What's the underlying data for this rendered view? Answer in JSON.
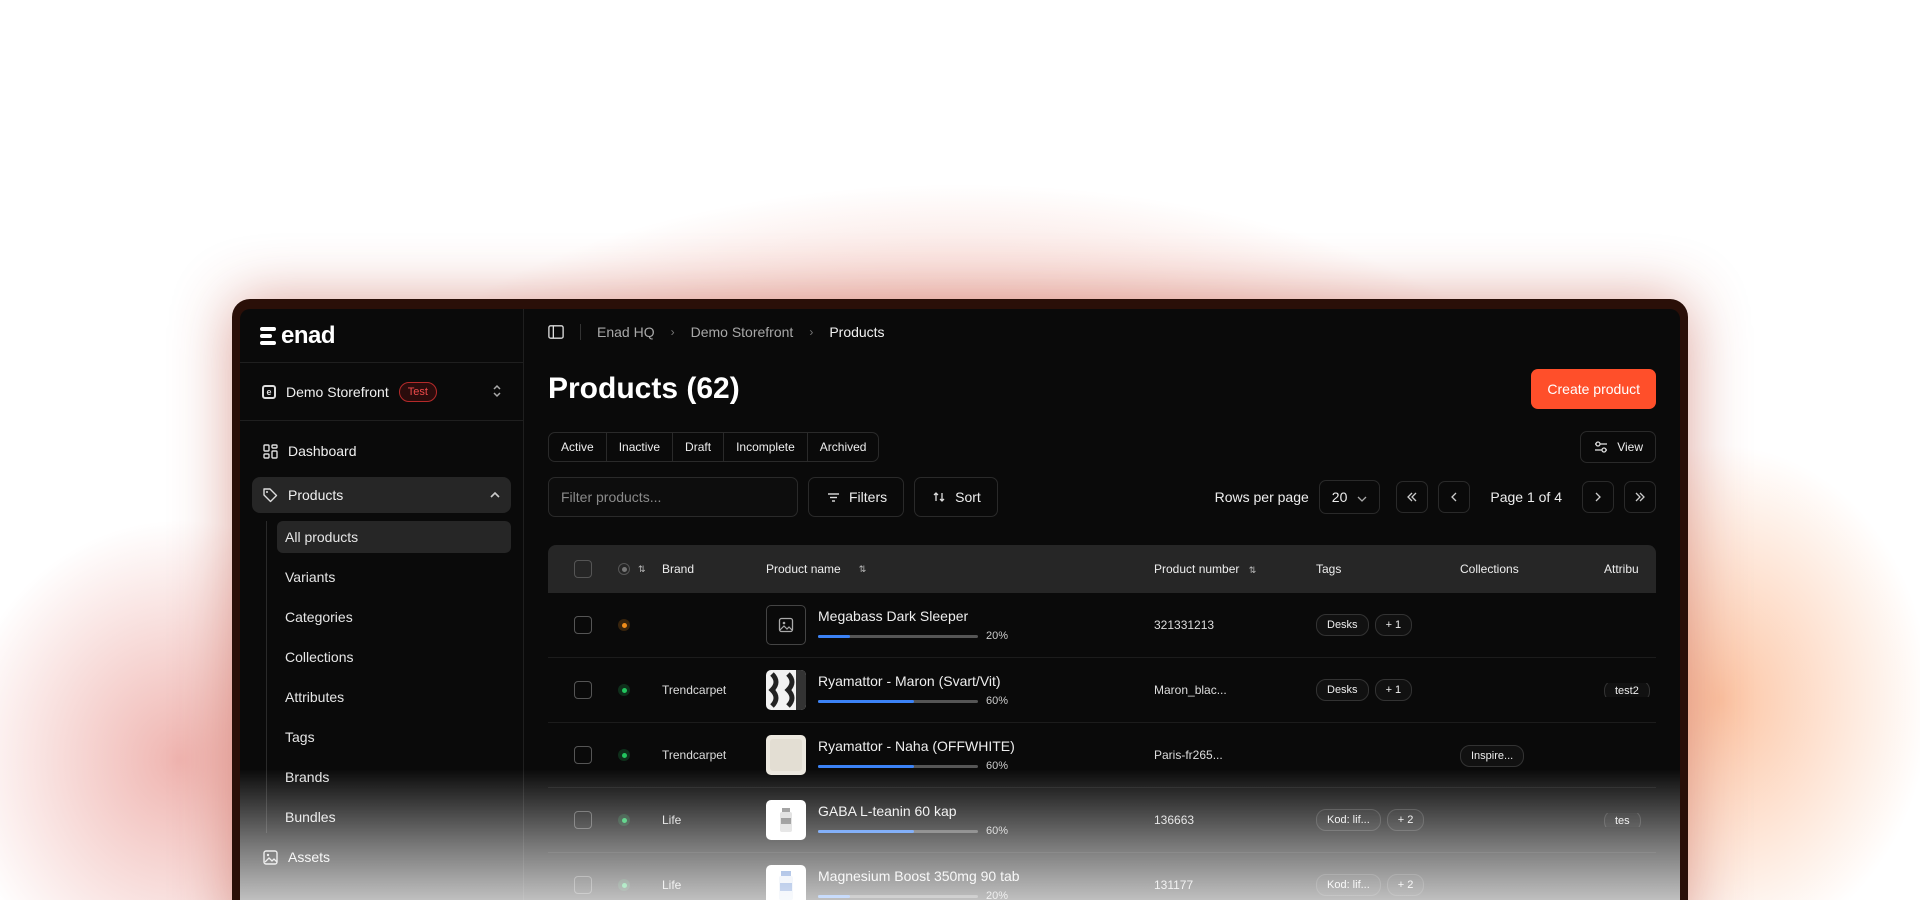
{
  "brand": {
    "logo_text": "enad"
  },
  "store": {
    "name": "Demo Storefront",
    "badge": "Test"
  },
  "nav": {
    "dashboard": "Dashboard",
    "products": "Products",
    "sub_items": [
      "All products",
      "Variants",
      "Categories",
      "Collections",
      "Attributes",
      "Tags",
      "Brands",
      "Bundles"
    ],
    "assets": "Assets"
  },
  "breadcrumb": [
    "Enad HQ",
    "Demo Storefront",
    "Products"
  ],
  "page": {
    "title": "Products (62)",
    "create_label": "Create product"
  },
  "status_tabs": [
    "Active",
    "Inactive",
    "Draft",
    "Incomplete",
    "Archived"
  ],
  "view_label": "View",
  "toolbar": {
    "filter_placeholder": "Filter products...",
    "filters_label": "Filters",
    "sort_label": "Sort",
    "rows_per_page_label": "Rows per page",
    "rows_per_page_value": "20",
    "page_label": "Page 1 of 4"
  },
  "table": {
    "headers": {
      "brand": "Brand",
      "name": "Product name",
      "number": "Product number",
      "tags": "Tags",
      "collections": "Collections",
      "attributes": "Attribu"
    },
    "rows": [
      {
        "status": "#f08c1a",
        "brand": "",
        "name": "Megabass Dark Sleeper",
        "progress_label": "20%",
        "progress": 0.2,
        "number": "321331213",
        "tags": [
          "Desks",
          "+ 1"
        ],
        "collection": "",
        "attribute": "",
        "thumb": "placeholder"
      },
      {
        "status": "#22c55e",
        "brand": "Trendcarpet",
        "name": "Ryamattor - Maron (Svart/Vit)",
        "progress_label": "60%",
        "progress": 0.6,
        "number": "Maron_blac...",
        "tags": [
          "Desks",
          "+ 1"
        ],
        "collection": "",
        "attribute": "test2",
        "thumb": "rug-bw"
      },
      {
        "status": "#22c55e",
        "brand": "Trendcarpet",
        "name": "Ryamattor - Naha (OFFWHITE)",
        "progress_label": "60%",
        "progress": 0.6,
        "number": "Paris-fr265...",
        "tags": [],
        "collection": "Inspire...",
        "attribute": "",
        "thumb": "rug-white"
      },
      {
        "status": "#22c55e",
        "brand": "Life",
        "name": "GABA L-teanin 60 kap",
        "progress_label": "60%",
        "progress": 0.6,
        "number": "136663",
        "tags": [
          "Kod: lif...",
          "+ 2"
        ],
        "collection": "",
        "attribute": "tes",
        "thumb": "bottle"
      },
      {
        "status": "#22c55e",
        "brand": "Life",
        "name": "Magnesium Boost 350mg 90 tab",
        "progress_label": "20%",
        "progress": 0.2,
        "number": "131177",
        "tags": [
          "Kod: lif...",
          "+ 2"
        ],
        "collection": "",
        "attribute": "",
        "thumb": "bottle-blue"
      }
    ]
  },
  "colors": {
    "accent": "#ff4f2a",
    "progress": "#3b82f6",
    "test_badge": "#ef4b4b"
  }
}
